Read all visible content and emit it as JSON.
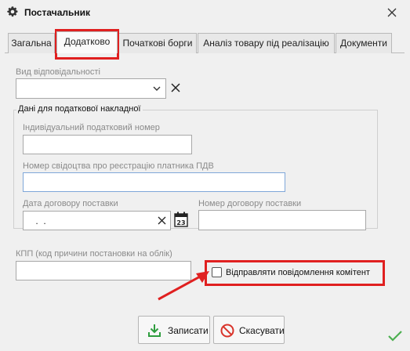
{
  "window": {
    "title": "Постачальник",
    "icon": "gear-icon",
    "close_icon": "close-icon"
  },
  "tabs": [
    {
      "label": "Загальна",
      "active": false
    },
    {
      "label": "Додатково",
      "active": true
    },
    {
      "label": "Початкові борги",
      "active": false
    },
    {
      "label": "Аналіз товару під реалізацію",
      "active": false
    },
    {
      "label": "Документи",
      "active": false
    }
  ],
  "form": {
    "responsibility_type": {
      "label": "Вид відповідальності",
      "value": ""
    },
    "tax_group": {
      "title": "Дані для податкової накладної",
      "tax_number": {
        "label": "Індивідуальний податковий номер",
        "value": ""
      },
      "vat_certificate": {
        "label": "Номер свідоцтва про реєстрацію платника ПДВ",
        "value": ""
      },
      "contract_date": {
        "label": "Дата договору поставки",
        "value": " .  ."
      },
      "contract_number": {
        "label": "Номер договору поставки",
        "value": ""
      }
    },
    "kpp": {
      "label": "КПП (код причини постановки на облік)",
      "value": ""
    },
    "send_commission_messages": {
      "label": "Відправляти повідомлення комітент",
      "checked": false
    }
  },
  "buttons": {
    "save": {
      "label": "Записати",
      "icon": "save-download-icon"
    },
    "cancel": {
      "label": "Скасувати",
      "icon": "cancel-circle-icon"
    }
  },
  "status": {
    "icon": "checkmark-icon"
  },
  "colors": {
    "highlight": "#e02020",
    "save_icon": "#2e9d3e",
    "cancel_icon": "#d9342b",
    "check": "#4caf50"
  }
}
